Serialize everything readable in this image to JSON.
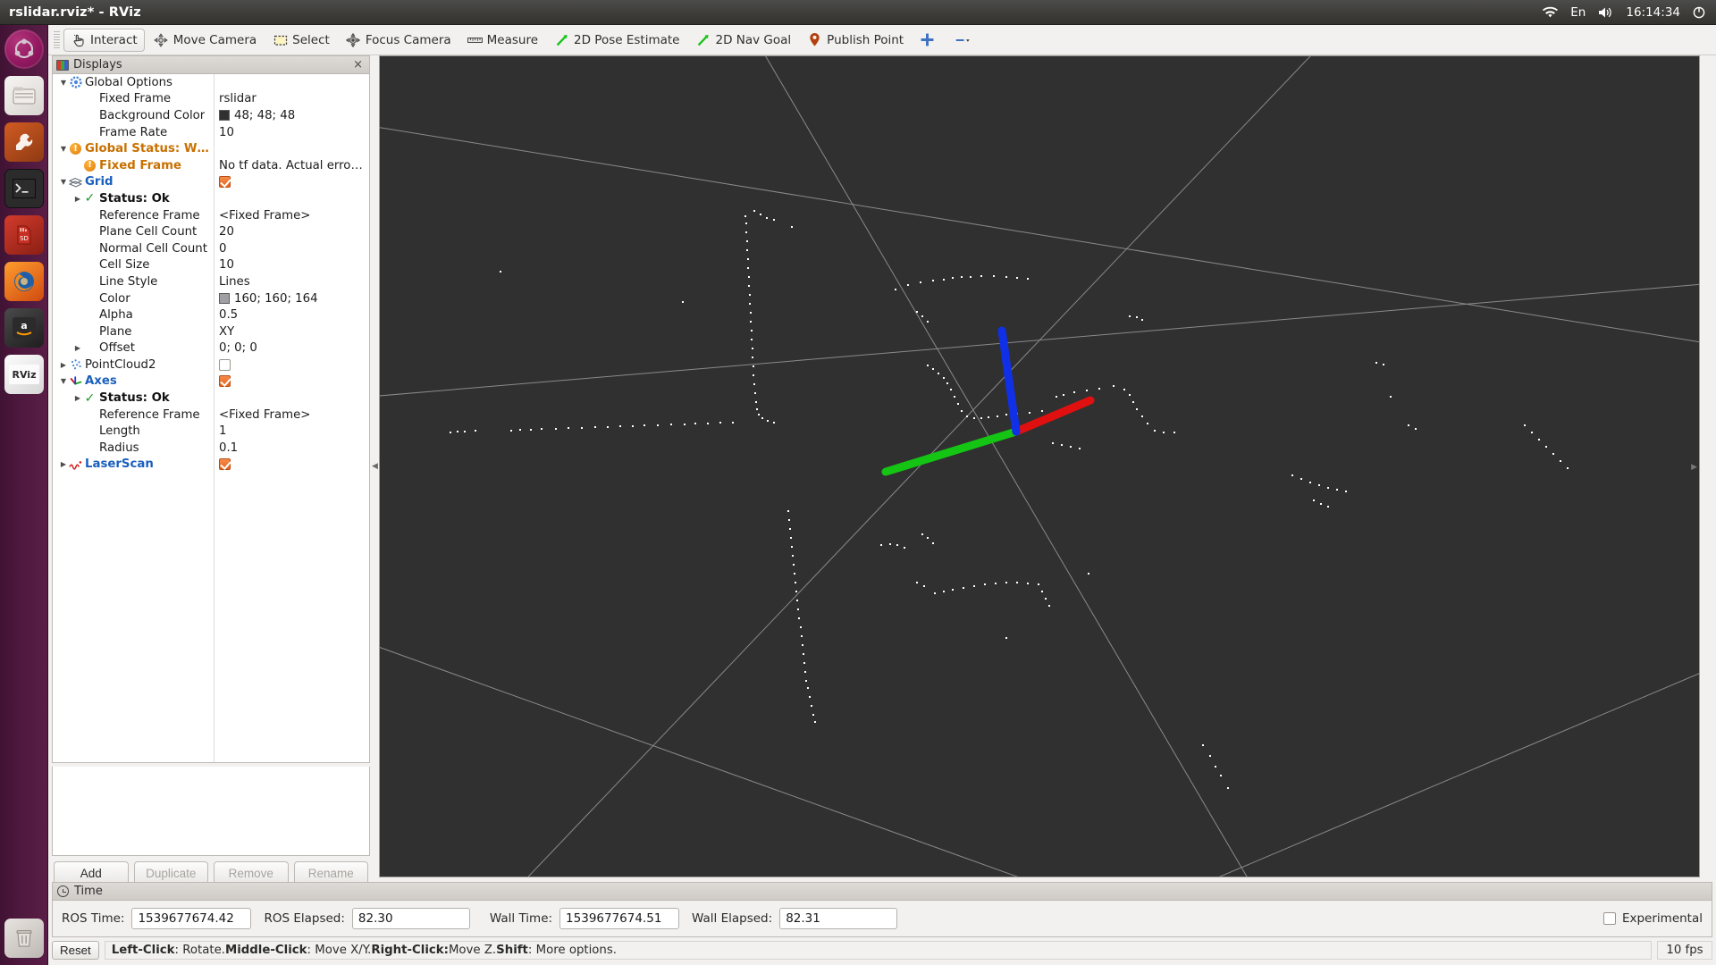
{
  "window": {
    "title": "rslidar.rviz* - RViz"
  },
  "system_tray": {
    "wifi_icon": "wifi-icon",
    "keyboard_layout": "En",
    "volume_icon": "volume-icon",
    "clock": "16:14:34",
    "power_icon": "power-icon"
  },
  "launcher": {
    "items": [
      {
        "name": "ubuntu-dash",
        "icon": "ubuntu-logo-icon",
        "glyph": ""
      },
      {
        "name": "files",
        "icon": "files-icon",
        "glyph": "▤"
      },
      {
        "name": "software-updater",
        "icon": "wrench-icon",
        "glyph": "🔧"
      },
      {
        "name": "terminal",
        "icon": "terminal-icon",
        "glyph": ">_"
      },
      {
        "name": "sd-card",
        "icon": "sd-card-icon",
        "glyph": "SD"
      },
      {
        "name": "firefox",
        "icon": "firefox-icon",
        "glyph": "●"
      },
      {
        "name": "amazon",
        "icon": "amazon-icon",
        "glyph": "A"
      },
      {
        "name": "rviz",
        "icon": "rviz-icon",
        "glyph": "RViz"
      },
      {
        "name": "trash",
        "icon": "trash-icon",
        "glyph": "🗑"
      }
    ]
  },
  "toolbar": {
    "tools": [
      {
        "label": "Interact",
        "icon": "hand-cursor-icon",
        "active": true
      },
      {
        "label": "Move Camera",
        "icon": "move-camera-icon",
        "active": false
      },
      {
        "label": "Select",
        "icon": "select-rect-icon",
        "active": false
      },
      {
        "label": "Focus Camera",
        "icon": "focus-camera-icon",
        "active": false
      },
      {
        "label": "Measure",
        "icon": "ruler-icon",
        "active": false
      },
      {
        "label": "2D Pose Estimate",
        "icon": "green-arrow-icon",
        "active": false
      },
      {
        "label": "2D Nav Goal",
        "icon": "green-arrow-icon",
        "active": false
      },
      {
        "label": "Publish Point",
        "icon": "map-pin-icon",
        "active": false
      },
      {
        "label": "",
        "icon": "plus-tool-icon",
        "active": false
      },
      {
        "label": "",
        "icon": "minus-dropdown-icon",
        "active": false
      }
    ]
  },
  "displays": {
    "panel_title": "Displays",
    "close_label": "×",
    "tree": [
      {
        "indent": 0,
        "arrow": "▼",
        "icon": "gear-icon",
        "label": "Global Options",
        "style": "plain",
        "value": "",
        "value_type": "none"
      },
      {
        "indent": 1,
        "arrow": "",
        "icon": "",
        "label": "Fixed Frame",
        "style": "plain",
        "value": "rslidar",
        "value_type": "text"
      },
      {
        "indent": 1,
        "arrow": "",
        "icon": "",
        "label": "Background Color",
        "style": "plain",
        "value": "48; 48; 48",
        "value_type": "color",
        "color": "#303030"
      },
      {
        "indent": 1,
        "arrow": "",
        "icon": "",
        "label": "Frame Rate",
        "style": "plain",
        "value": "10",
        "value_type": "text"
      },
      {
        "indent": 0,
        "arrow": "▼",
        "icon": "warning-icon",
        "label": "Global Status: W…",
        "style": "orange",
        "value": "",
        "value_type": "none"
      },
      {
        "indent": 1,
        "arrow": "",
        "icon": "warning-icon",
        "label": "Fixed Frame",
        "style": "orange",
        "value": "No tf data.  Actual erro…",
        "value_type": "text"
      },
      {
        "indent": 0,
        "arrow": "▼",
        "icon": "grid-icon",
        "label": "Grid",
        "style": "blue",
        "value": "",
        "value_type": "checkbox",
        "checked": true
      },
      {
        "indent": 1,
        "arrow": "▶",
        "icon": "ok-check-icon",
        "label": "Status: Ok",
        "style": "bold",
        "value": "",
        "value_type": "none"
      },
      {
        "indent": 1,
        "arrow": "",
        "icon": "",
        "label": "Reference Frame",
        "style": "plain",
        "value": "<Fixed Frame>",
        "value_type": "text"
      },
      {
        "indent": 1,
        "arrow": "",
        "icon": "",
        "label": "Plane Cell Count",
        "style": "plain",
        "value": "20",
        "value_type": "text"
      },
      {
        "indent": 1,
        "arrow": "",
        "icon": "",
        "label": "Normal Cell Count",
        "style": "plain",
        "value": "0",
        "value_type": "text"
      },
      {
        "indent": 1,
        "arrow": "",
        "icon": "",
        "label": "Cell Size",
        "style": "plain",
        "value": "10",
        "value_type": "text"
      },
      {
        "indent": 1,
        "arrow": "",
        "icon": "",
        "label": "Line Style",
        "style": "plain",
        "value": "Lines",
        "value_type": "text"
      },
      {
        "indent": 1,
        "arrow": "",
        "icon": "",
        "label": "Color",
        "style": "plain",
        "value": "160; 160; 164",
        "value_type": "color",
        "color": "#a0a0a4"
      },
      {
        "indent": 1,
        "arrow": "",
        "icon": "",
        "label": "Alpha",
        "style": "plain",
        "value": "0.5",
        "value_type": "text"
      },
      {
        "indent": 1,
        "arrow": "",
        "icon": "",
        "label": "Plane",
        "style": "plain",
        "value": "XY",
        "value_type": "text"
      },
      {
        "indent": 1,
        "arrow": "▶",
        "icon": "",
        "label": "Offset",
        "style": "plain",
        "value": "0; 0; 0",
        "value_type": "text"
      },
      {
        "indent": 0,
        "arrow": "▶",
        "icon": "pointcloud-icon",
        "label": "PointCloud2",
        "style": "plain",
        "value": "",
        "value_type": "checkbox",
        "checked": false
      },
      {
        "indent": 0,
        "arrow": "▼",
        "icon": "axes-icon",
        "label": "Axes",
        "style": "blue",
        "value": "",
        "value_type": "checkbox",
        "checked": true
      },
      {
        "indent": 1,
        "arrow": "▶",
        "icon": "ok-check-icon",
        "label": "Status: Ok",
        "style": "bold",
        "value": "",
        "value_type": "none"
      },
      {
        "indent": 1,
        "arrow": "",
        "icon": "",
        "label": "Reference Frame",
        "style": "plain",
        "value": "<Fixed Frame>",
        "value_type": "text"
      },
      {
        "indent": 1,
        "arrow": "",
        "icon": "",
        "label": "Length",
        "style": "plain",
        "value": "1",
        "value_type": "text"
      },
      {
        "indent": 1,
        "arrow": "",
        "icon": "",
        "label": "Radius",
        "style": "plain",
        "value": "0.1",
        "value_type": "text"
      },
      {
        "indent": 0,
        "arrow": "▶",
        "icon": "laserscan-icon",
        "label": "LaserScan",
        "style": "blue",
        "value": "",
        "value_type": "checkbox",
        "checked": true
      }
    ],
    "buttons": [
      {
        "label": "Add",
        "enabled": true
      },
      {
        "label": "Duplicate",
        "enabled": false
      },
      {
        "label": "Remove",
        "enabled": false
      },
      {
        "label": "Rename",
        "enabled": false
      }
    ]
  },
  "time_panel": {
    "title": "Time",
    "fields": [
      {
        "label": "ROS Time:",
        "value": "1539677674.42"
      },
      {
        "label": "ROS Elapsed:",
        "value": "82.30"
      },
      {
        "label": "Wall Time:",
        "value": "1539677674.51"
      },
      {
        "label": "Wall Elapsed:",
        "value": "82.31"
      }
    ],
    "experimental_label": "Experimental",
    "experimental_checked": false
  },
  "status_bar": {
    "reset_label": "Reset",
    "hint_parts": [
      {
        "text": "Left-Click",
        "bold": true
      },
      {
        "text": ": Rotate.  ",
        "bold": false
      },
      {
        "text": "Middle-Click",
        "bold": true
      },
      {
        "text": ": Move X/Y.  ",
        "bold": false
      },
      {
        "text": "Right-Click:",
        "bold": true
      },
      {
        "text": " Move Z.  ",
        "bold": false
      },
      {
        "text": "Shift",
        "bold": true
      },
      {
        "text": ": More options.",
        "bold": false
      }
    ],
    "fps": "10 fps"
  },
  "viewport": {
    "background_color": "#303030",
    "grid_line_color": "#9a9a9e",
    "point_color": "#ffffff",
    "axes": {
      "x_color": "#e01010",
      "y_color": "#14c514",
      "z_color": "#1030e8"
    }
  }
}
